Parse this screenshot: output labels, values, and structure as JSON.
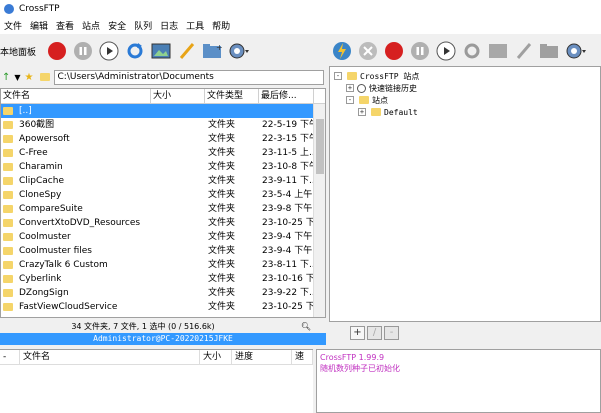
{
  "app": {
    "title": "CrossFTP"
  },
  "menu": [
    "文件",
    "编辑",
    "查看",
    "站点",
    "安全",
    "队列",
    "日志",
    "工具",
    "帮助"
  ],
  "left_toolbar": {
    "label": "本地面板",
    "icons": [
      "stop-icon",
      "pause-icon",
      "play-icon",
      "refresh-icon",
      "image-icon",
      "edit-icon",
      "new-folder-icon",
      "settings-icon"
    ]
  },
  "right_toolbar": {
    "icons": [
      "connect-icon",
      "disconnect-icon",
      "stop-icon",
      "pause-icon",
      "play-icon",
      "refresh-icon",
      "image-icon",
      "edit-icon",
      "new-folder-icon",
      "settings-icon"
    ]
  },
  "path": {
    "value": "C:\\Users\\Administrator\\Documents"
  },
  "columns": {
    "name": "文件名",
    "size": "大小",
    "type": "文件类型",
    "date": "最后修..."
  },
  "files": [
    {
      "name": "[..]",
      "type": "",
      "date": ""
    },
    {
      "name": "360截图",
      "type": "文件夹",
      "date": "22-5-19 下午..."
    },
    {
      "name": "Apowersoft",
      "type": "文件夹",
      "date": "22-3-15 下午..."
    },
    {
      "name": "C-Free",
      "type": "文件夹",
      "date": "23-11-5 上..."
    },
    {
      "name": "Charamin",
      "type": "文件夹",
      "date": "23-10-8 下午..."
    },
    {
      "name": "ClipCache",
      "type": "文件夹",
      "date": "23-9-11 下..."
    },
    {
      "name": "CloneSpy",
      "type": "文件夹",
      "date": "23-5-4 上午..."
    },
    {
      "name": "CompareSuite",
      "type": "文件夹",
      "date": "23-9-8 下午..."
    },
    {
      "name": "ConvertXtoDVD_Resources",
      "type": "文件夹",
      "date": "23-10-25 下..."
    },
    {
      "name": "Coolmuster",
      "type": "文件夹",
      "date": "23-9-4 下午..."
    },
    {
      "name": "Coolmuster files",
      "type": "文件夹",
      "date": "23-9-4 下午..."
    },
    {
      "name": "CrazyTalk 6 Custom",
      "type": "文件夹",
      "date": "23-8-11 下..."
    },
    {
      "name": "Cyberlink",
      "type": "文件夹",
      "date": "23-10-16 下..."
    },
    {
      "name": "DZongSign",
      "type": "文件夹",
      "date": "23-9-22 下..."
    },
    {
      "name": "FastViewCloudService",
      "type": "文件夹",
      "date": "23-10-25 下..."
    }
  ],
  "status": {
    "summary": "34 文件夹, 7 文件, 1 选中 (0 / 516.6k)"
  },
  "host": "Administrator@PC-20220215JFKE",
  "site_tree": {
    "root": "CrossFTP 站点",
    "history": "快速链接历史",
    "sites": "站点",
    "default": "Default"
  },
  "right_small_toolbar": [
    "+",
    "/",
    "-"
  ],
  "queue": {
    "cols": [
      "-",
      "文件名",
      "大小",
      "进度",
      "速"
    ]
  },
  "log": [
    "CrossFTP 1.99.9",
    "随机数列种子已初始化"
  ]
}
